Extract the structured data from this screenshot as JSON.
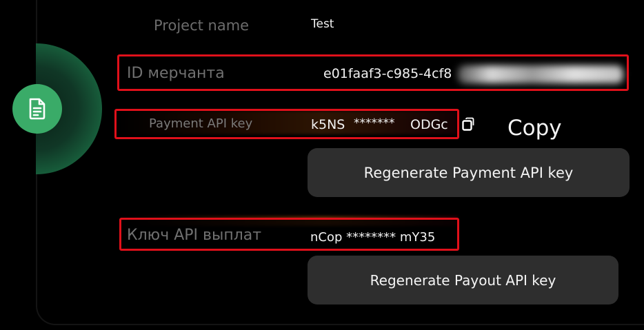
{
  "project": {
    "label": "Project name",
    "value": "Test"
  },
  "merchant": {
    "label": "ID мерчанта",
    "value": "e01faaf3-c985-4cf8"
  },
  "payment_key": {
    "label": "Payment API key",
    "value_start": "k5NS",
    "value_mask": "*******",
    "value_end": "ODGc",
    "copy_label": "Copy",
    "copy_icon": "copy-icon",
    "regenerate_label": "Regenerate Payment API key"
  },
  "payout_key": {
    "label": "Ключ API выплат",
    "value": "nCop ******** mY35",
    "regenerate_label": "Regenerate Payout API key"
  },
  "sidebar": {
    "icon": "document-icon",
    "accent_color": "#3aab68"
  },
  "highlight_color": "#e0101a"
}
